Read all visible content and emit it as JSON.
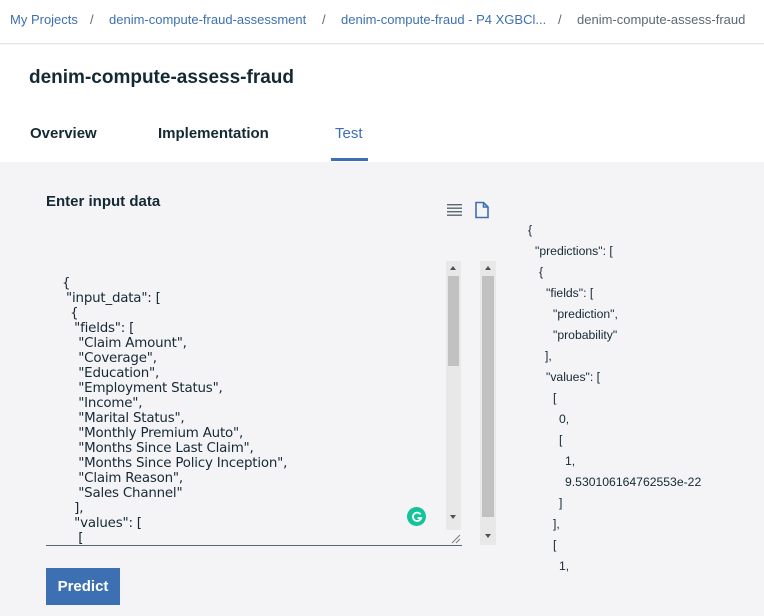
{
  "breadcrumb": {
    "items": [
      "My Projects",
      "denim-compute-fraud-assessment",
      "denim-compute-fraud - P4 XGBCl...",
      "denim-compute-assess-fraud"
    ],
    "separator": "/"
  },
  "header": {
    "title": "denim-compute-assess-fraud",
    "tabs": [
      "Overview",
      "Implementation",
      "Test"
    ],
    "active_tab": "Test"
  },
  "test": {
    "section_title": "Enter input data",
    "toolbar_icons": [
      "list-icon",
      "file-icon"
    ],
    "input_text": "{\n \"input_data\": [\n  {\n   \"fields\": [\n    \"Claim Amount\",\n    \"Coverage\",\n    \"Education\",\n    \"Employment Status\",\n    \"Income\",\n    \"Marital Status\",\n    \"Monthly Premium Auto\",\n    \"Months Since Last Claim\",\n    \"Months Since Policy Inception\",\n    \"Claim Reason\",\n    \"Sales Channel\"\n   ],\n   \"values\": [\n    [",
    "predict_label": "Predict"
  },
  "output": {
    "lines": [
      "{",
      "\"predictions\": [",
      "{",
      "\"fields\": [",
      "\"prediction\",",
      "\"probability\"",
      "],",
      "\"values\": [",
      "[",
      "0,",
      "[",
      "1,",
      "9.530106164762553e-22",
      "]",
      "],",
      "[",
      "1,"
    ]
  },
  "colors": {
    "accent": "#3d70b2",
    "text": "#152935",
    "background": "#f4f4f6"
  }
}
